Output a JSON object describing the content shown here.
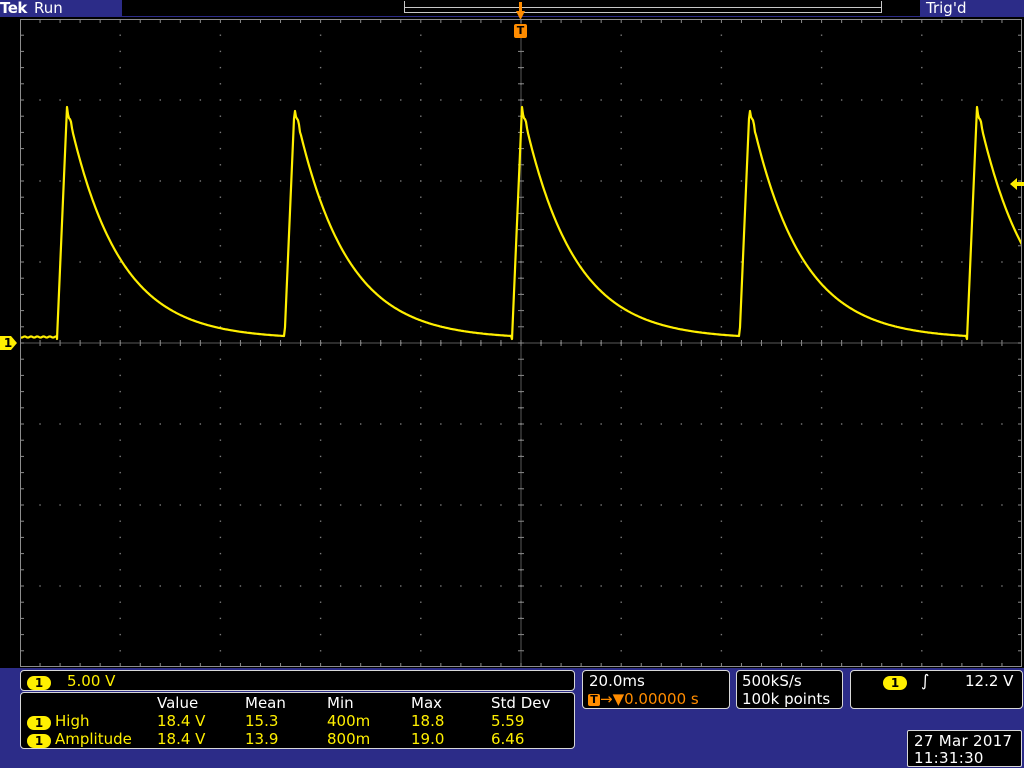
{
  "header": {
    "brand": "Tek",
    "run_state": "Run",
    "trig_state": "Trig'd",
    "trig_marker": "T",
    "ground_marker": "1"
  },
  "channel": {
    "badge": "1",
    "scale": "5.00 V"
  },
  "timebase": {
    "per_div": "20.0ms",
    "trig_marker": "T",
    "delay": "→▼0.00000 s"
  },
  "acquisition": {
    "sample_rate": "500kS/s",
    "record_length": "100k points"
  },
  "trigger": {
    "source": "1",
    "slope": "∫",
    "level": "12.2 V"
  },
  "measurements": {
    "headers": [
      "Value",
      "Mean",
      "Min",
      "Max",
      "Std Dev"
    ],
    "rows": [
      {
        "ch": "1",
        "name": "High",
        "value": "18.4 V",
        "mean": "15.3",
        "min": "400m",
        "max": "18.8",
        "std": "5.59"
      },
      {
        "ch": "1",
        "name": "Amplitude",
        "value": "18.4 V",
        "mean": "13.9",
        "min": "800m",
        "max": "19.0",
        "std": "6.46"
      }
    ]
  },
  "clock": {
    "date": "27 Mar 2017",
    "time": "11:31:30"
  },
  "colors": {
    "trace": "#ffef00",
    "trigger": "#ff8c00",
    "statusbar": "#2c2c88"
  }
}
